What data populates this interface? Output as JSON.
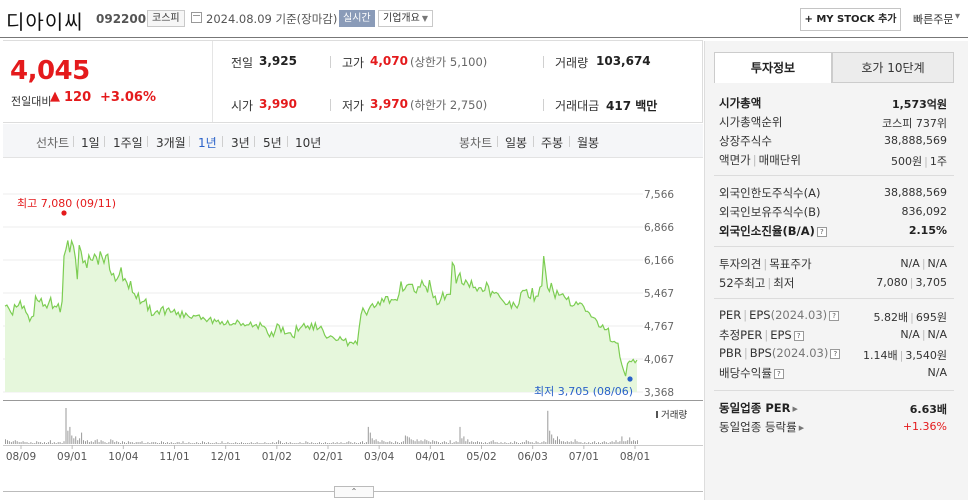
{
  "header": {
    "stock_name": "디아이씨",
    "stock_code": "092200",
    "market": "코스피",
    "date_text": "2024.08.09  기준(장마감)",
    "realtime_label": "실시간",
    "company_overview_label": "기업개요",
    "my_stock_label": "+ MY STOCK 추가",
    "quick_order_label": "빠른주문"
  },
  "price": {
    "current": "4,045",
    "compare_label": "전일대비",
    "change_arrow": "▲",
    "change_value": "120",
    "change_rate": "+3.06%"
  },
  "quotes": {
    "prev_label": "전일",
    "prev_value": "3,925",
    "high_label": "고가",
    "high_value": "4,070",
    "upper_limit": "(상한가 5,100)",
    "volume_label": "거래량",
    "volume_value": "103,674",
    "open_label": "시가",
    "open_value": "3,990",
    "low_label": "저가",
    "low_value": "3,970",
    "lower_limit": "(하한가 2,750)",
    "amount_label": "거래대금",
    "amount_value": "417 백만"
  },
  "period_bar": {
    "line_label": "선차트",
    "line_items": [
      "1일",
      "1주일",
      "3개월",
      "1년",
      "3년",
      "5년",
      "10년"
    ],
    "selected_index": 3,
    "candle_label": "봉차트",
    "candle_items": [
      "일봉",
      "주봉",
      "월봉"
    ]
  },
  "chart_data": {
    "type": "area",
    "y_ticks": [
      "7,566",
      "6,866",
      "6,166",
      "5,467",
      "4,767",
      "4,067",
      "3,368"
    ],
    "ylim": [
      3368,
      7566
    ],
    "x_ticks": [
      "08/09",
      "09/01",
      "10/04",
      "11/01",
      "12/01",
      "01/02",
      "02/01",
      "03/04",
      "04/01",
      "05/02",
      "06/03",
      "07/01",
      "08/01"
    ],
    "max_label": "최고 7,080 (09/11)",
    "min_label": "최저 3,705 (08/06)",
    "volume_label": "거래량",
    "line_color": "#7ccd52",
    "fill_color": "#e6f7dc",
    "max_color": "#e41a1c",
    "min_color": "#2a62c9",
    "values": [
      5190,
      5210,
      5140,
      5060,
      5000,
      5220,
      5170,
      5200,
      5300,
      5140,
      5190,
      5060,
      5000,
      4870,
      4960,
      4980,
      5400,
      5310,
      5280,
      5350,
      5190,
      5220,
      5150,
      5260,
      5370,
      5140,
      5190,
      5170,
      5240,
      5060,
      5290,
      6250,
      6390,
      6580,
      6330,
      6570,
      6460,
      6210,
      5760,
      6480,
      6350,
      6110,
      6150,
      6000,
      6270,
      6170,
      6160,
      6290,
      6230,
      6070,
      6350,
      6230,
      6100,
      6260,
      6290,
      5960,
      5850,
      5880,
      5720,
      5770,
      5850,
      6010,
      5730,
      5770,
      5690,
      5560,
      5720,
      5480,
      5450,
      5350,
      5460,
      5240,
      5280,
      5290,
      5340,
      5100,
      5200,
      4990,
      5000,
      5060,
      5090,
      5020,
      5140,
      5180,
      5010,
      5120,
      5150,
      5060,
      5070,
      5120,
      5010,
      5060,
      4950,
      5080,
      4950,
      5040,
      4990,
      4950,
      4930,
      4990,
      4980,
      4990,
      5000,
      4910,
      4950,
      4910,
      4860,
      4910,
      4950,
      4820,
      4910,
      4860,
      4890,
      4810,
      4860,
      4790,
      4810,
      4880,
      4790,
      4790,
      4820,
      4810,
      4890,
      4850,
      4780,
      4820,
      4770,
      4790,
      4790,
      4850,
      4750,
      4780,
      4800,
      4710,
      4840,
      4770,
      4760,
      4720,
      4610,
      4540,
      4640,
      4550,
      4670,
      4810,
      4780,
      4640,
      4740,
      4600,
      4610,
      4620,
      4620,
      4540,
      4520,
      4770,
      4660,
      4720,
      4760,
      4820,
      4730,
      4770,
      4700,
      4820,
      4690,
      4830,
      4690,
      4720,
      4760,
      4680,
      4570,
      4510,
      4530,
      4560,
      4540,
      4500,
      4460,
      4470,
      4540,
      4480,
      4460,
      4500,
      4350,
      4420,
      4420,
      4390,
      4450,
      4380,
      4720,
      5010,
      5150,
      5070,
      5000,
      5110,
      5190,
      5240,
      5160,
      5200,
      5280,
      5210,
      5350,
      5280,
      5390,
      5390,
      5250,
      5330,
      5320,
      5330,
      5310,
      5440,
      5710,
      5510,
      5550,
      5630,
      5650,
      5650,
      5650,
      5500,
      5470,
      5600,
      5590,
      5730,
      5630,
      5600,
      5480,
      5740,
      5530,
      5370,
      5400,
      5220,
      5240,
      5340,
      5480,
      5330,
      5430,
      5440,
      5440,
      6110,
      6040,
      5670,
      5820,
      5890,
      5670,
      5640,
      5740,
      5680,
      5590,
      5730,
      5580,
      5590,
      5510,
      5580,
      5580,
      5500,
      5520,
      5690,
      5610,
      5400,
      5500,
      5460,
      5480,
      5450,
      5380,
      5330,
      5280,
      5220,
      5230,
      5290,
      5150,
      5270,
      5200,
      5150,
      5240,
      5470,
      5520,
      5520,
      5540,
      5380,
      5350,
      5570,
      5300,
      5400,
      5400,
      5590,
      5620,
      6250,
      5920,
      5580,
      5500,
      5680,
      5510,
      5360,
      5520,
      5420,
      5430,
      5450,
      5380,
      5330,
      5380,
      5200,
      5190,
      5210,
      5280,
      5220,
      5260,
      5240,
      5180,
      5080,
      5080,
      5040,
      4960,
      4950,
      4930,
      4870,
      4750,
      4740,
      4790,
      4690,
      4690,
      4720,
      4450,
      4430,
      4440,
      4410,
      4400,
      4110,
      3950,
      3820,
      3705,
      3970,
      4020,
      4010,
      4060,
      3990,
      4045
    ],
    "volumes": [
      5,
      4,
      3,
      2,
      3,
      4,
      3,
      2,
      2,
      3,
      2,
      2,
      1,
      2,
      1,
      1,
      3,
      2,
      2,
      1,
      2,
      1,
      2,
      4,
      1,
      2,
      1,
      2,
      2,
      1,
      3,
      38,
      14,
      18,
      9,
      6,
      8,
      4,
      6,
      12,
      4,
      3,
      4,
      2,
      3,
      2,
      4,
      5,
      2,
      4,
      3,
      2,
      1,
      2,
      5,
      4,
      2,
      3,
      2,
      1,
      3,
      2,
      1,
      3,
      2,
      2,
      1,
      2,
      2,
      2,
      3,
      1,
      1,
      2,
      1,
      2,
      2,
      2,
      1,
      1,
      3,
      2,
      1,
      2,
      1,
      2,
      1,
      1,
      2,
      2,
      1,
      3,
      1,
      1,
      2,
      1,
      1,
      1,
      2,
      1,
      1,
      3,
      2,
      1,
      2,
      1,
      1,
      1,
      2,
      1,
      1,
      3,
      1,
      1,
      2,
      1,
      1,
      1,
      2,
      1,
      1,
      2,
      1,
      1,
      1,
      1,
      2,
      1,
      1,
      2,
      1,
      1,
      1,
      2,
      1,
      1,
      1,
      2,
      1,
      2,
      4,
      3,
      1,
      1,
      2,
      1,
      2,
      1,
      1,
      1,
      1,
      2,
      1,
      1,
      3,
      2,
      1,
      2,
      1,
      1,
      1,
      2,
      1,
      1,
      2,
      1,
      1,
      1,
      2,
      1,
      2,
      1,
      2,
      1,
      1,
      2,
      3,
      2,
      1,
      2,
      1,
      1,
      2,
      3,
      1,
      2,
      18,
      12,
      6,
      4,
      5,
      3,
      2,
      4,
      3,
      2,
      2,
      3,
      2,
      1,
      3,
      2,
      1,
      2,
      3,
      9,
      8,
      7,
      5,
      4,
      3,
      5,
      3,
      4,
      3,
      5,
      4,
      3,
      2,
      4,
      3,
      3,
      2,
      1,
      2,
      3,
      2,
      1,
      4,
      1,
      2,
      3,
      2,
      18,
      6,
      8,
      3,
      5,
      2,
      3,
      2,
      2,
      3,
      2,
      2,
      1,
      2,
      1,
      2,
      3,
      4,
      2,
      2,
      1,
      2,
      1,
      2,
      1,
      1,
      2,
      1,
      3,
      2,
      1,
      1,
      2,
      2,
      4,
      3,
      2,
      2,
      1,
      3,
      2,
      1,
      2,
      3,
      2,
      35,
      14,
      10,
      6,
      4,
      8,
      5,
      3,
      3,
      2,
      3,
      2,
      3,
      2,
      5,
      3,
      2,
      2,
      1,
      2,
      1,
      2,
      1,
      2,
      3,
      1,
      2,
      1,
      2,
      3,
      2,
      1,
      2,
      3,
      2,
      4,
      2,
      3,
      8,
      3,
      3,
      4,
      7,
      3,
      4,
      3,
      4
    ]
  },
  "collapse_label": "⌃",
  "right_panel": {
    "tab_invest": "투자정보",
    "tab_hoga": "호가 10단계",
    "market_cap_label": "시가총액",
    "market_cap_value": "1,573억원",
    "cap_rank_label": "시가총액순위",
    "cap_rank_value": "코스피 737위",
    "shares_label": "상장주식수",
    "shares_value": "38,888,569",
    "face_value_label": "액면가",
    "trade_unit_label": "매매단위",
    "face_value_value": "500원",
    "trade_unit_value": "1주",
    "foreign_limit_label": "외국인한도주식수(A)",
    "foreign_limit_value": "38,888,569",
    "foreign_hold_label": "외국인보유주식수(B)",
    "foreign_hold_value": "836,092",
    "foreign_ratio_label": "외국인소진율(B/A)",
    "foreign_ratio_value": "2.15%",
    "opinion_label": "투자의견",
    "target_label": "목표주가",
    "opinion_value": "N/A",
    "target_value": "N/A",
    "week52_label": "52주최고",
    "week52_low_label": "최저",
    "week52_high_value": "7,080",
    "week52_low_value": "3,705",
    "per_label": "PER",
    "eps_label": "EPS",
    "eps_period": "(2024.03)",
    "per_value": "5.82배",
    "eps_value": "695원",
    "est_per_label": "추정PER",
    "est_eps_label": "EPS",
    "est_per_value": "N/A",
    "est_eps_value": "N/A",
    "pbr_label": "PBR",
    "bps_label": "BPS",
    "bps_period": "(2024.03)",
    "pbr_value": "1.14배",
    "bps_value": "3,540원",
    "dividend_label": "배당수익률",
    "dividend_value": "N/A",
    "ind_per_label": "동일업종 PER",
    "ind_per_value": "6.63배",
    "ind_rate_label": "동일업종 등락률",
    "ind_rate_value": "+1.36%"
  }
}
